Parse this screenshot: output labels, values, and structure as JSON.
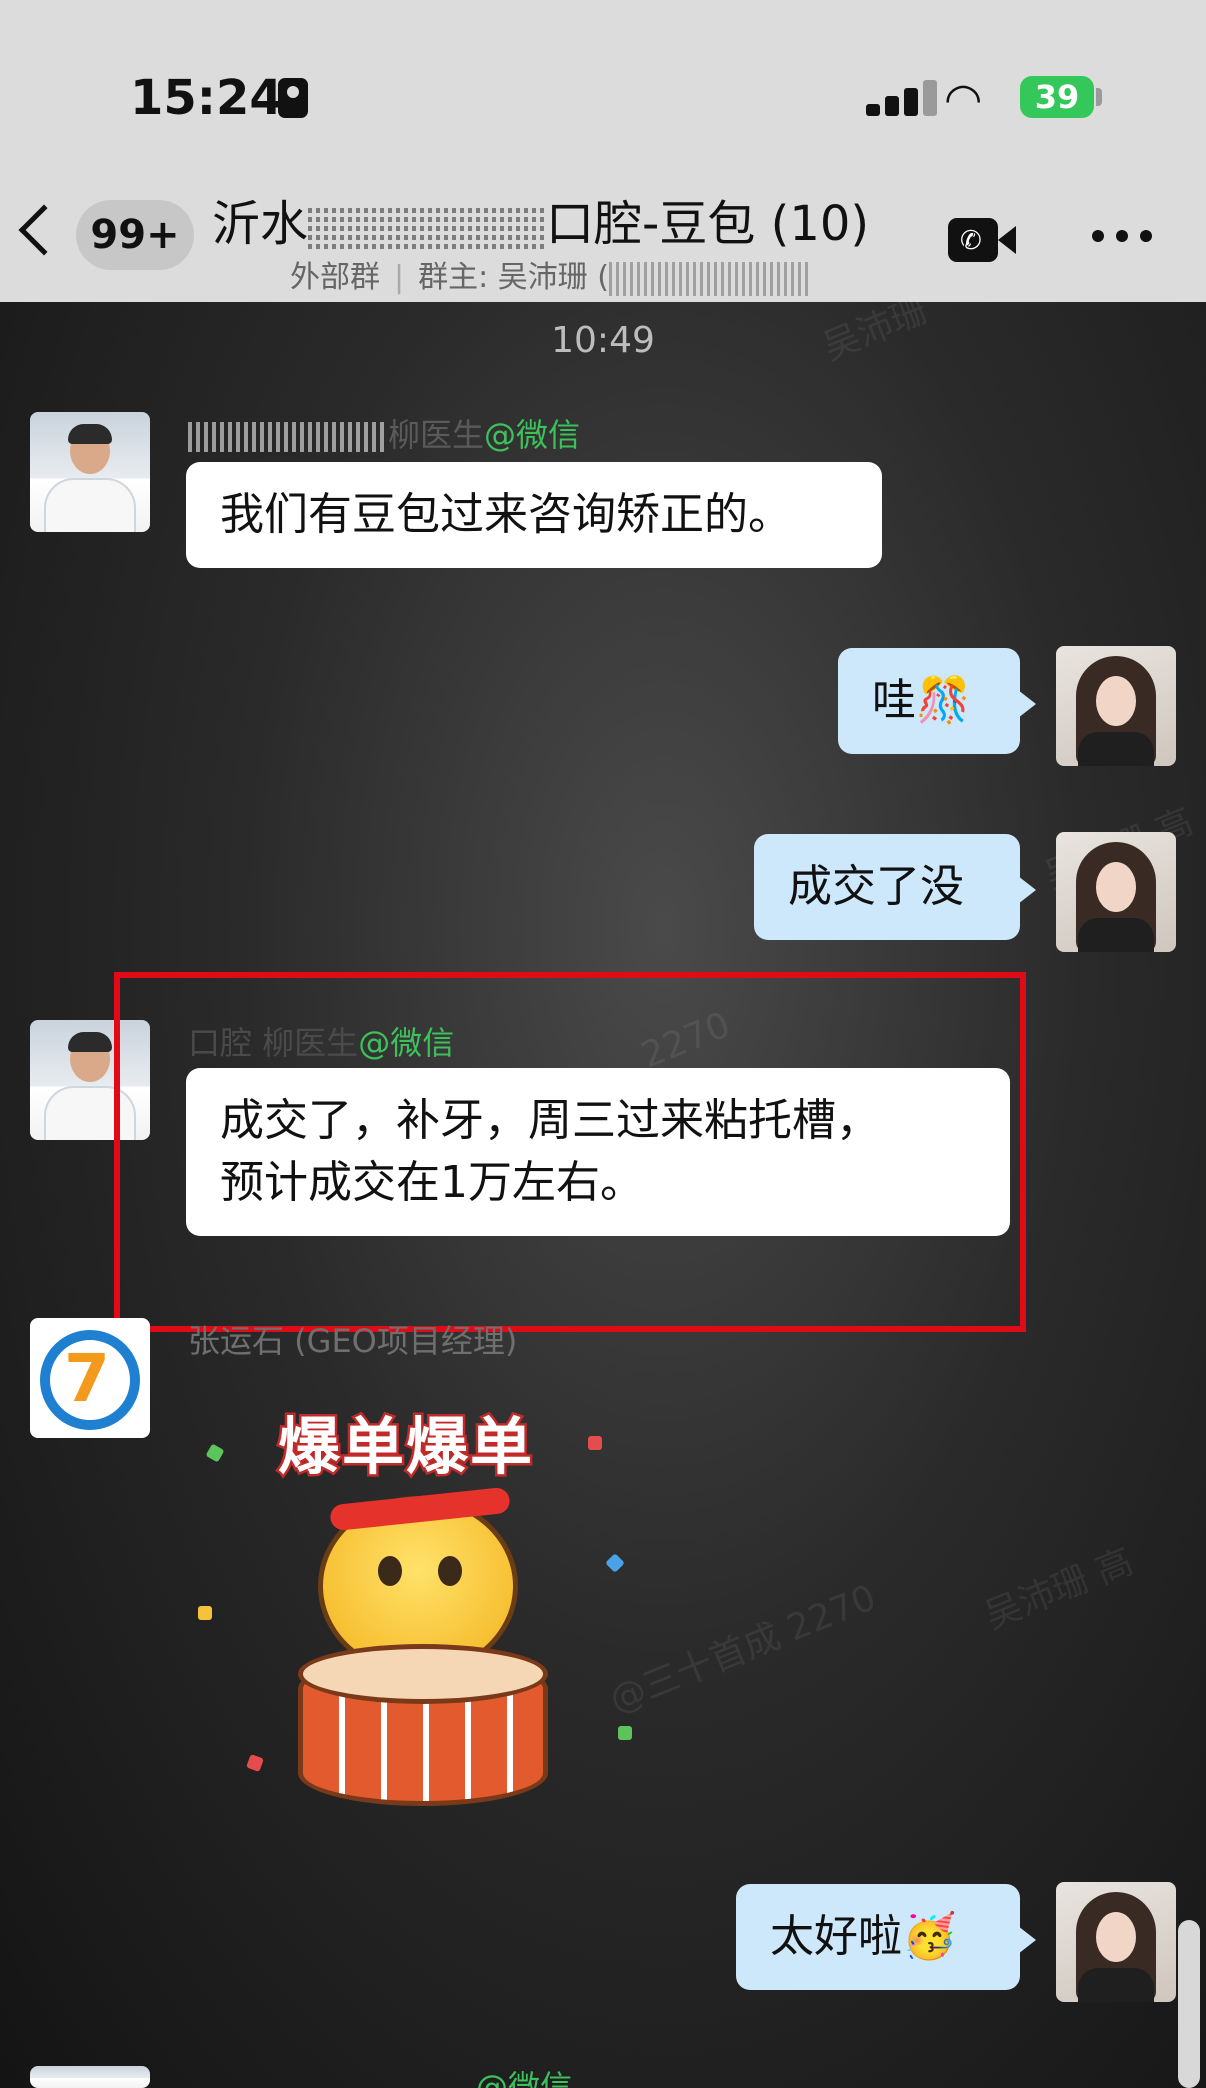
{
  "status_bar": {
    "time": "15:24",
    "battery": "39"
  },
  "header": {
    "unread_count": "99+",
    "title_prefix": "沂水",
    "title_suffix": "口腔-豆包 (10)",
    "subtitle_group_type": "外部群",
    "subtitle_owner": "群主: 吴沛珊 ("
  },
  "watermarks": [
    "吴沛珊",
    "吴沛珊 高",
    "吴沛珊 高",
    "@三十首成 2270",
    "2270"
  ],
  "messages": [
    {
      "timestamp": "10:49"
    },
    {
      "sender_source": "@微信",
      "sender_name_visible": "柳医生",
      "text": "我们有豆包过来咨询矫正的。"
    },
    {
      "text": "哇🎊"
    },
    {
      "text": "成交了没"
    },
    {
      "sender_name": "口腔 柳医生",
      "sender_source": "@微信",
      "text_line1": "成交了，补牙，周三过来粘托槽，",
      "text_line2": "预计成交在1万左右。"
    },
    {
      "sender_name": "张运石 (GEO项目经理)",
      "sticker_text": "爆单爆单"
    },
    {
      "text": "太好啦🥳"
    },
    {
      "sender_source": "@微信"
    }
  ],
  "colors": {
    "highlight": "#e10b17",
    "wechat_green": "#3cc15b",
    "outgoing_bubble": "#cde7fb",
    "battery_green": "#34c759"
  }
}
